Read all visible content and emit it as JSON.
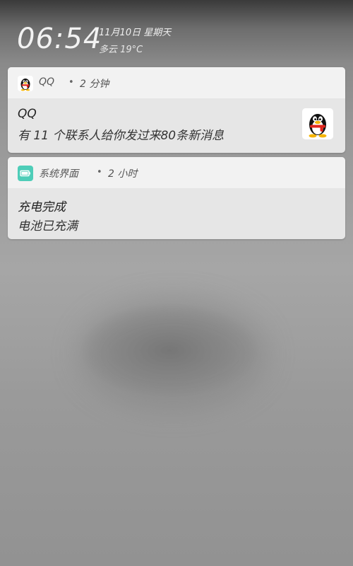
{
  "status": {
    "time": "06:54",
    "date": "11月10日 星期天",
    "weather": "多云 19°C"
  },
  "notifications": [
    {
      "app_name": "QQ",
      "separator": "•",
      "time_ago": "2 分钟",
      "title": "QQ",
      "text": "有 11 个联系人给你发过来80条新消息",
      "app_icon": "qq-penguin-icon",
      "large_icon": "qq-penguin-icon"
    },
    {
      "app_name": "系统界面",
      "separator": "•",
      "time_ago": "2 小时",
      "title": "充电完成",
      "text": "电池已充满",
      "app_icon": "battery-icon",
      "app_icon_color": "#4ecdb8"
    }
  ]
}
